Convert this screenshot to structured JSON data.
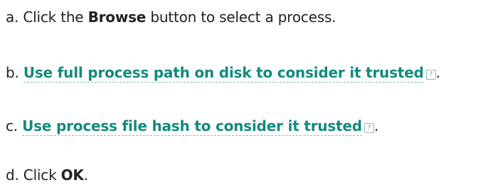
{
  "steps": [
    {
      "prefix": "a. Click the ",
      "bold": "Browse",
      "suffix": " button to select a process."
    },
    {
      "prefix": "b. ",
      "link": "Use full process path on disk to consider it trusted",
      "help_icon": "?",
      "suffix": "."
    },
    {
      "prefix": "c. ",
      "link": "Use process file hash to consider it trusted",
      "help_icon": "?",
      "suffix": "."
    },
    {
      "prefix": "d. Click ",
      "bold": "OK",
      "suffix": "."
    }
  ],
  "colors": {
    "text": "#222222",
    "link": "#128a7d",
    "link_underline": "#7fc3bb"
  },
  "icons": {
    "help": "help-icon"
  }
}
